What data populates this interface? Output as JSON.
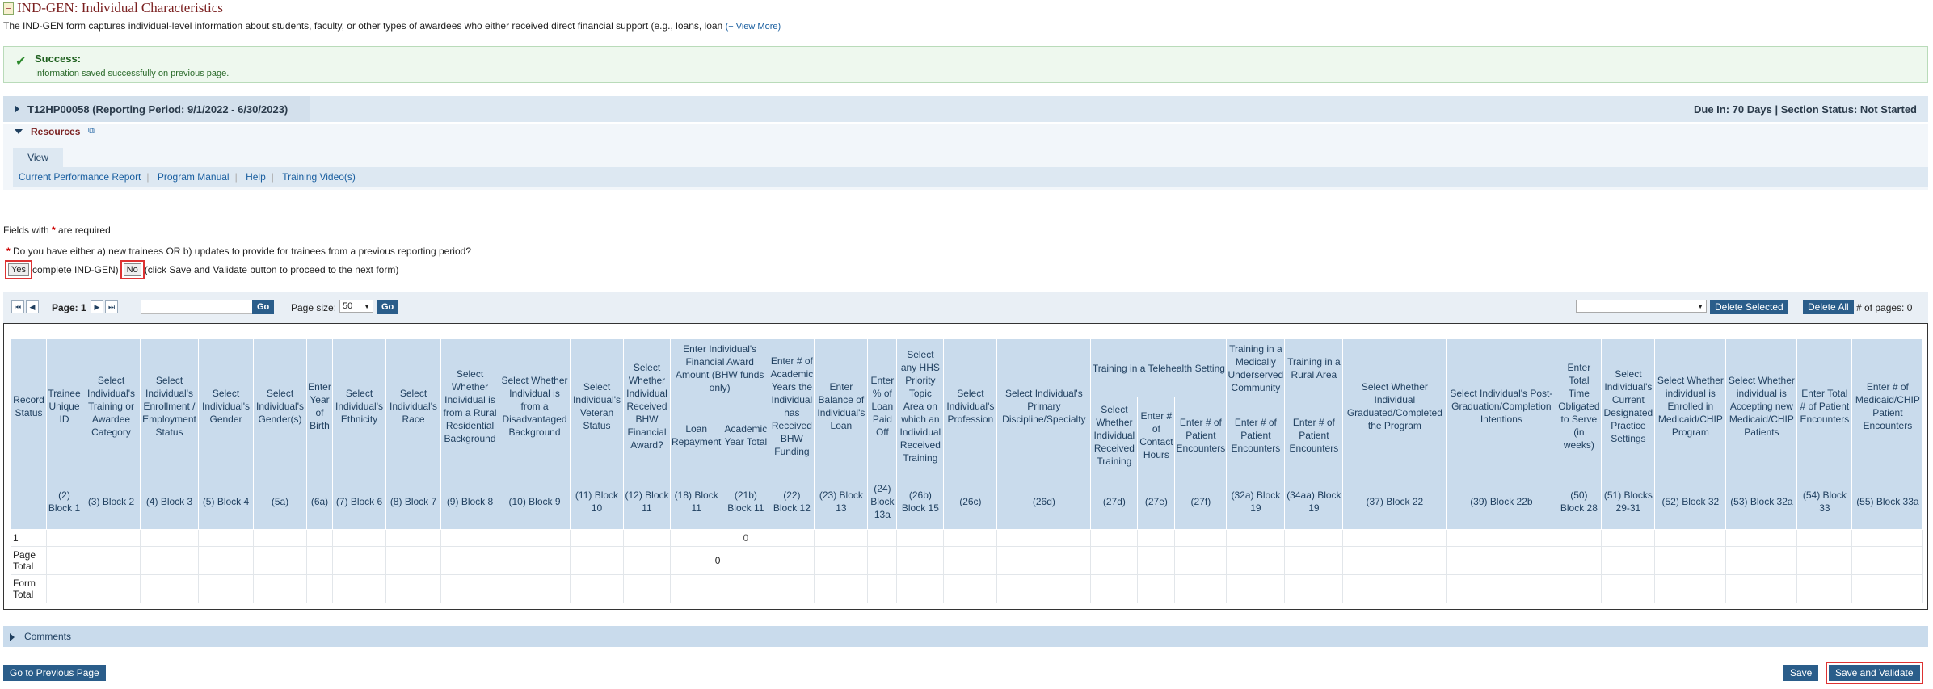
{
  "page": {
    "title": "IND-GEN: Individual Characteristics",
    "description": "The IND-GEN form captures individual-level information about students, faculty, or other types of awardees who either received direct financial support (e.g., loans, loan",
    "view_more": "(+ View More)"
  },
  "success": {
    "title": "Success:",
    "message": "Information saved successfully on previous page."
  },
  "grant": {
    "title": "T12HP00058 (Reporting Period: 9/1/2022 - 6/30/2023)",
    "status": "Due In: 70 Days | Section Status: Not Started"
  },
  "resources": {
    "title": "Resources",
    "tab": "View",
    "links": [
      "Current Performance Report",
      "Program Manual",
      "Help",
      "Training Video(s)"
    ]
  },
  "required_note": {
    "prefix": "Fields with",
    "suffix": "are required"
  },
  "question": "Do you have either a) new trainees OR b) updates to provide for trainees from a previous reporting period?",
  "answer": {
    "yes": "Yes",
    "yes_text": "complete IND-GEN)",
    "no": "No",
    "no_text": "(click Save and Validate button to proceed to the next form)"
  },
  "pager": {
    "page_label": "Page: 1",
    "go": "Go",
    "page_size_label": "Page size:",
    "page_size": "50",
    "delete_selected": "Delete Selected",
    "delete_all": "Delete All",
    "pages_label": "# of pages: 0"
  },
  "grid": {
    "headers": [
      {
        "label": "Record Status",
        "code": ""
      },
      {
        "label": "Trainee Unique ID",
        "code": "(2) Block 1"
      },
      {
        "label": "Select Individual's Training or Awardee Category",
        "code": "(3) Block 2"
      },
      {
        "label": "Select Individual's Enrollment / Employment Status",
        "code": "(4) Block 3"
      },
      {
        "label": "Select Individual's Gender",
        "code": "(5) Block 4"
      },
      {
        "label": "Select Individual's Gender(s)",
        "code": "(5a)"
      },
      {
        "label": "Enter Year of Birth",
        "code": "(6a)"
      },
      {
        "label": "Select Individual's Ethnicity",
        "code": "(7) Block 6"
      },
      {
        "label": "Select Individual's Race",
        "code": "(8) Block 7"
      },
      {
        "label": "Select Whether Individual is from a Rural Residential Background",
        "code": "(9) Block 8"
      },
      {
        "label": "Select Whether Individual is from a Disadvantaged Background",
        "code": "(10) Block 9"
      },
      {
        "label": "Select Individual's Veteran Status",
        "code": "(11) Block 10"
      },
      {
        "label": "Select Whether Individual Received BHW Financial Award?",
        "code": "(12) Block 11"
      },
      {
        "label": "Loan Repayment",
        "code": "(18) Block 11"
      },
      {
        "label": "Academic Year Total",
        "code": "(21b) Block 11"
      },
      {
        "label": "Enter # of Academic Years the Individual has Received BHW Funding",
        "code": "(22) Block 12"
      },
      {
        "label": "Enter Balance of Individual's Loan",
        "code": "(23) Block 13"
      },
      {
        "label": "Enter % of Loan Paid Off",
        "code": "(24) Block 13a"
      },
      {
        "label": "Select any HHS Priority Topic Area on which an Individual Received Training",
        "code": "(26b) Block 15"
      },
      {
        "label": "Select Individual's Profession",
        "code": "(26c)"
      },
      {
        "label": "Select Individual's Primary Discipline/Specialty",
        "code": "(26d)"
      },
      {
        "label": "Select Whether Individual Received Training",
        "code": "(27d)"
      },
      {
        "label": "Enter # of Contact Hours",
        "code": "(27e)"
      },
      {
        "label": "Enter # of Patient Encounters",
        "code": "(27f)"
      },
      {
        "label": "Enter # of Patient Encounters",
        "code": "(32a) Block 19"
      },
      {
        "label": "Enter # of Patient Encounters",
        "code": "(34aa) Block 19"
      },
      {
        "label": "Select Whether Individual Graduated/Completed the Program",
        "code": "(37) Block 22"
      },
      {
        "label": "Select Individual's Post-Graduation/Completion Intentions",
        "code": "(39) Block 22b"
      },
      {
        "label": "Enter Total Time Obligated to Serve (in weeks)",
        "code": "(50) Block 28"
      },
      {
        "label": "Select Individual's Current Designated Practice Settings",
        "code": "(51) Blocks 29-31"
      },
      {
        "label": "Select Whether individual is Enrolled in Medicaid/CHIP Program",
        "code": "(52) Block 32"
      },
      {
        "label": "Select Whether individual is Accepting new Medicaid/CHIP Patients",
        "code": "(53) Block 32a"
      },
      {
        "label": "Enter Total # of Patient Encounters",
        "code": "(54) Block 33"
      },
      {
        "label": "Enter # of Medicaid/CHIP Patient Encounters",
        "code": "(55) Block 33a"
      }
    ],
    "group_headers": {
      "financial": "Enter Individual's Financial Award Amount (BHW funds only)",
      "telehealth": "Training in a Telehealth Setting",
      "underserved": "Training in a Medically Underserved Community",
      "rural": "Training in a Rural Area"
    },
    "row1": {
      "index": "1",
      "academic_total": "0"
    },
    "page_total": {
      "label": "Page Total",
      "value": "0"
    },
    "form_total": {
      "label": "Form Total"
    }
  },
  "comments": "Comments",
  "buttons": {
    "previous": "Go to Previous Page",
    "save": "Save",
    "save_validate": "Save and Validate"
  }
}
